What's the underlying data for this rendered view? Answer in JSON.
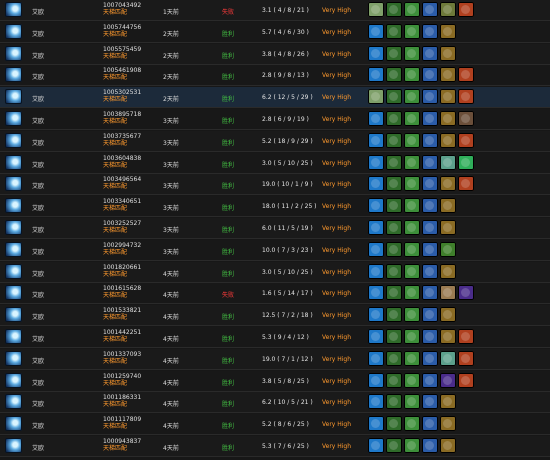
{
  "rows": [
    {
      "hero": "艾欧",
      "match_id": "1007043492",
      "mode": "天梯匹配",
      "time": "1天前",
      "result": "失败",
      "result_type": "loss",
      "kda": "3.1 ( 4 / 8 / 21 )",
      "skill": "Very High",
      "items": [
        "ghost-scepter",
        "wand",
        "boots",
        "bracer",
        "shadow-blade",
        "dagon"
      ]
    },
    {
      "hero": "艾欧",
      "match_id": "1005744756",
      "mode": "天梯匹配",
      "time": "2天前",
      "result": "胜利",
      "result_type": "win",
      "kda": "5.7 ( 4 / 6 / 30 )",
      "skill": "Very High",
      "items": [
        "orb",
        "wand",
        "boots",
        "bracer",
        "urn"
      ]
    },
    {
      "hero": "艾欧",
      "match_id": "1005575459",
      "mode": "天梯匹配",
      "time": "2天前",
      "result": "胜利",
      "result_type": "win",
      "kda": "3.8 ( 4 / 8 / 26 )",
      "skill": "Very High",
      "items": [
        "orb",
        "wand",
        "boots",
        "bracer",
        "urn"
      ]
    },
    {
      "hero": "艾欧",
      "match_id": "1005461908",
      "mode": "天梯匹配",
      "time": "2天前",
      "result": "胜利",
      "result_type": "win",
      "kda": "2.8 ( 9 / 8 / 13 )",
      "skill": "Very High",
      "items": [
        "orb",
        "wand",
        "boots",
        "bracer",
        "urn",
        "dagon"
      ]
    },
    {
      "hero": "艾欧",
      "match_id": "1005302531",
      "mode": "天梯匹配",
      "time": "2天前",
      "result": "胜利",
      "result_type": "win",
      "kda": "6.2 ( 12 / 5 / 29 )",
      "skill": "Very High",
      "items": [
        "ghost-scepter",
        "wand",
        "boots",
        "bracer",
        "urn",
        "dagon"
      ],
      "highlight": true
    },
    {
      "hero": "艾欧",
      "match_id": "1003895718",
      "mode": "天梯匹配",
      "time": "3天前",
      "result": "胜利",
      "result_type": "win",
      "kda": "2.8 ( 6 / 9 / 19 )",
      "skill": "Very High",
      "items": [
        "orb",
        "wand",
        "boots",
        "bracer",
        "urn",
        "armor"
      ]
    },
    {
      "hero": "艾欧",
      "match_id": "1003735677",
      "mode": "天梯匹配",
      "time": "3天前",
      "result": "胜利",
      "result_type": "win",
      "kda": "5.2 ( 18 / 9 / 29 )",
      "skill": "Very High",
      "items": [
        "orb",
        "wand",
        "boots",
        "bracer",
        "urn",
        "dagon"
      ]
    },
    {
      "hero": "艾欧",
      "match_id": "1003604838",
      "mode": "天梯匹配",
      "time": "3天前",
      "result": "胜利",
      "result_type": "win",
      "kda": "3.0 ( 5 / 10 / 25 )",
      "skill": "Very High",
      "items": [
        "orb",
        "wand",
        "boots",
        "bracer",
        "ghost",
        "green-orb"
      ]
    },
    {
      "hero": "艾欧",
      "match_id": "1003496564",
      "mode": "天梯匹配",
      "time": "3天前",
      "result": "胜利",
      "result_type": "win",
      "kda": "19.0 ( 10 / 1 / 9 )",
      "skill": "Very High",
      "items": [
        "orb",
        "wand",
        "boots",
        "bracer",
        "urn",
        "dagon"
      ]
    },
    {
      "hero": "艾欧",
      "match_id": "1003340651",
      "mode": "天梯匹配",
      "time": "3天前",
      "result": "胜利",
      "result_type": "win",
      "kda": "18.0 ( 11 / 2 / 25 )",
      "skill": "Very High",
      "items": [
        "orb",
        "wand",
        "boots",
        "bracer",
        "urn"
      ]
    },
    {
      "hero": "艾欧",
      "match_id": "1003252527",
      "mode": "天梯匹配",
      "time": "3天前",
      "result": "胜利",
      "result_type": "win",
      "kda": "6.0 ( 11 / 5 / 19 )",
      "skill": "Very High",
      "items": [
        "orb",
        "wand",
        "boots",
        "bracer",
        "urn"
      ]
    },
    {
      "hero": "艾欧",
      "match_id": "1002994732",
      "mode": "天梯匹配",
      "time": "3天前",
      "result": "胜利",
      "result_type": "win",
      "kda": "10.0 ( 7 / 3 / 23 )",
      "skill": "Very High",
      "items": [
        "orb",
        "wand",
        "boots",
        "bracer",
        "leaf"
      ]
    },
    {
      "hero": "艾欧",
      "match_id": "1001820661",
      "mode": "天梯匹配",
      "time": "4天前",
      "result": "胜利",
      "result_type": "win",
      "kda": "3.0 ( 5 / 10 / 25 )",
      "skill": "Very High",
      "items": [
        "orb",
        "wand",
        "boots",
        "bracer",
        "urn"
      ]
    },
    {
      "hero": "艾欧",
      "match_id": "1001615628",
      "mode": "天梯匹配",
      "time": "4天前",
      "result": "失败",
      "result_type": "loss",
      "kda": "1.6 ( 5 / 14 / 17 )",
      "skill": "Very High",
      "items": [
        "orb",
        "wand",
        "boots",
        "bracer",
        "scroll",
        "purple-orb"
      ]
    },
    {
      "hero": "艾欧",
      "match_id": "1001533821",
      "mode": "天梯匹配",
      "time": "4天前",
      "result": "胜利",
      "result_type": "win",
      "kda": "12.5 ( 7 / 2 / 18 )",
      "skill": "Very High",
      "items": [
        "orb",
        "wand",
        "boots",
        "bracer",
        "urn"
      ]
    },
    {
      "hero": "艾欧",
      "match_id": "1001442251",
      "mode": "天梯匹配",
      "time": "4天前",
      "result": "胜利",
      "result_type": "win",
      "kda": "5.3 ( 9 / 4 / 12 )",
      "skill": "Very High",
      "items": [
        "orb",
        "wand",
        "boots",
        "bracer",
        "urn",
        "dagon"
      ]
    },
    {
      "hero": "艾欧",
      "match_id": "1001337093",
      "mode": "天梯匹配",
      "time": "4天前",
      "result": "胜利",
      "result_type": "win",
      "kda": "19.0 ( 7 / 1 / 12 )",
      "skill": "Very High",
      "items": [
        "orb",
        "wand",
        "boots",
        "bracer",
        "ghost",
        "dagon"
      ]
    },
    {
      "hero": "艾欧",
      "match_id": "1001259740",
      "mode": "天梯匹配",
      "time": "4天前",
      "result": "胜利",
      "result_type": "win",
      "kda": "3.8 ( 5 / 8 / 25 )",
      "skill": "Very High",
      "items": [
        "orb",
        "wand",
        "boots",
        "bracer",
        "purple-orb",
        "dagon"
      ]
    },
    {
      "hero": "艾欧",
      "match_id": "1001186331",
      "mode": "天梯匹配",
      "time": "4天前",
      "result": "胜利",
      "result_type": "win",
      "kda": "6.2 ( 10 / 5 / 21 )",
      "skill": "Very High",
      "items": [
        "orb",
        "wand",
        "boots",
        "bracer",
        "urn"
      ]
    },
    {
      "hero": "艾欧",
      "match_id": "1001117809",
      "mode": "天梯匹配",
      "time": "4天前",
      "result": "胜利",
      "result_type": "win",
      "kda": "5.2 ( 8 / 6 / 25 )",
      "skill": "Very High",
      "items": [
        "orb",
        "wand",
        "boots",
        "bracer",
        "urn"
      ]
    },
    {
      "hero": "艾欧",
      "match_id": "1000943837",
      "mode": "天梯匹配",
      "time": "4天前",
      "result": "胜利",
      "result_type": "win",
      "kda": "5.3 ( 7 / 6 / 25 )",
      "skill": "Very High",
      "items": [
        "orb",
        "wand",
        "boots",
        "bracer",
        "urn"
      ]
    }
  ],
  "item_colors": {
    "ghost-scepter": "#7fa06a",
    "orb": "#1e78c8",
    "wand": "#2f6b2a",
    "boots": "#3d8f3a",
    "bracer": "#2b5ca8",
    "shadow-blade": "#6e7a3a",
    "dagon": "#b0401f",
    "urn": "#8a6b24",
    "armor": "#6b4f3a",
    "ghost": "#5ca08c",
    "green-orb": "#2fae5a",
    "leaf": "#3f7f2b",
    "scroll": "#9a7b52",
    "purple-orb": "#4a2c8a"
  }
}
